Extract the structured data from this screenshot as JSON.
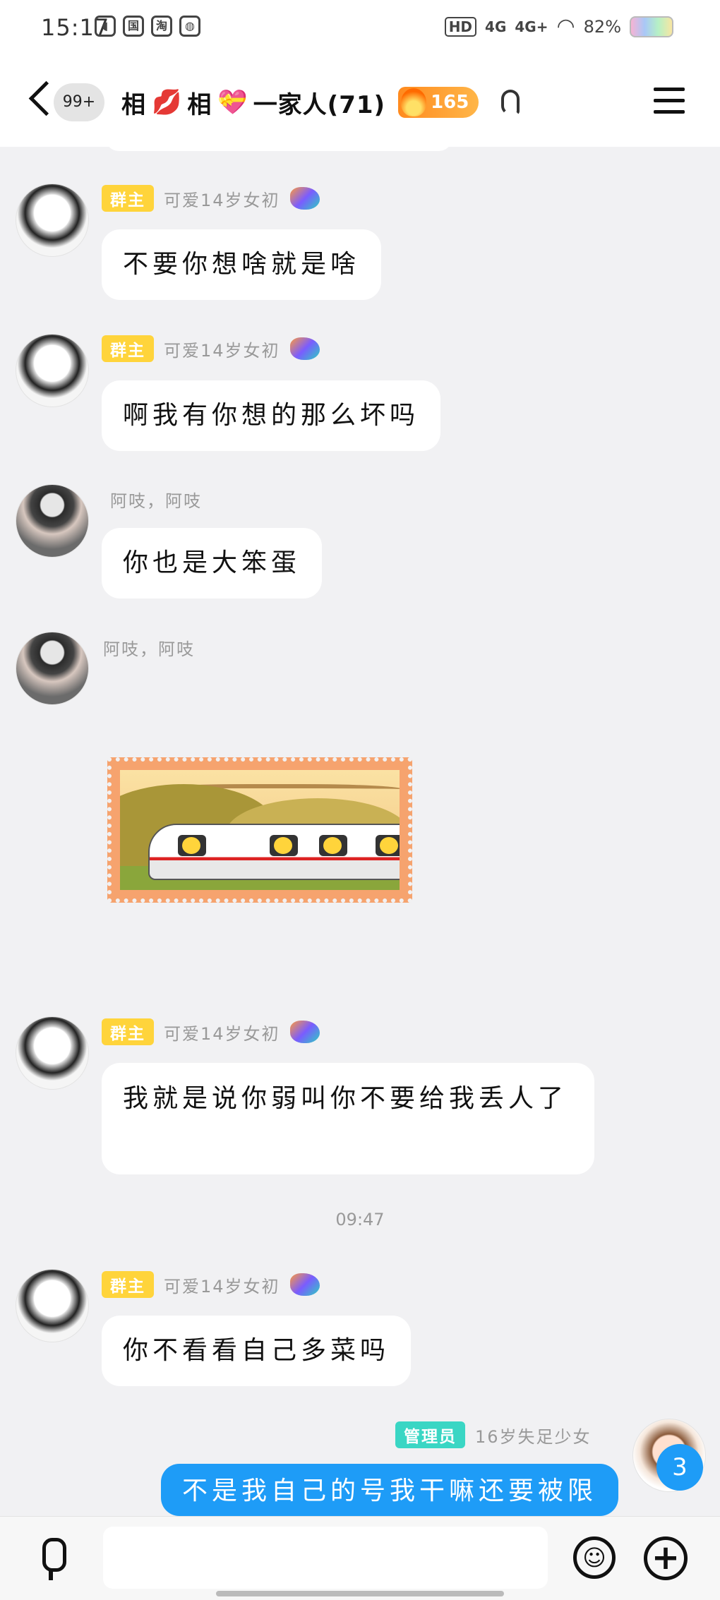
{
  "status_bar": {
    "time": "15:17",
    "left_icons": [
      "leaf-icon",
      "国",
      "淘",
      "app-icon"
    ],
    "hd_label": "HD",
    "signal1": "4G",
    "signal2": "4G+",
    "battery": "82%"
  },
  "header": {
    "unread": "99+",
    "title_part1": "相",
    "title_part2": "相",
    "title_part3": "一家人(71)",
    "title_emoji1": "💋",
    "title_emoji2": "💝",
    "fire_level": "165"
  },
  "messages": [
    {
      "badge": "群主",
      "name": "可爱14岁女初",
      "text": "不要你想啥就是啥"
    },
    {
      "badge": "群主",
      "name": "可爱14岁女初",
      "text": "啊我有你想的那么坏吗"
    },
    {
      "name": "阿吱，阿吱",
      "text": "你也是大笨蛋"
    },
    {
      "name": "阿吱，阿吱"
    },
    {
      "badge": "群主",
      "name": "可爱14岁女初",
      "text": "我就是说你弱叫你不要给我丢人了"
    },
    {
      "badge": "群主",
      "name": "可爱14岁女初",
      "text": "你不看看自己多菜吗"
    },
    {
      "badge": "管理员",
      "name": "16岁失足少女",
      "text": "不是我自己的号我干嘛还要被限"
    }
  ],
  "time_divider": "09:47",
  "floating_unread": "3",
  "colors": {
    "owner_badge": "#ffd43b",
    "admin_badge": "#3ad6c4",
    "self_bubble": "#1e9cf7",
    "background": "#f1f1f3"
  }
}
